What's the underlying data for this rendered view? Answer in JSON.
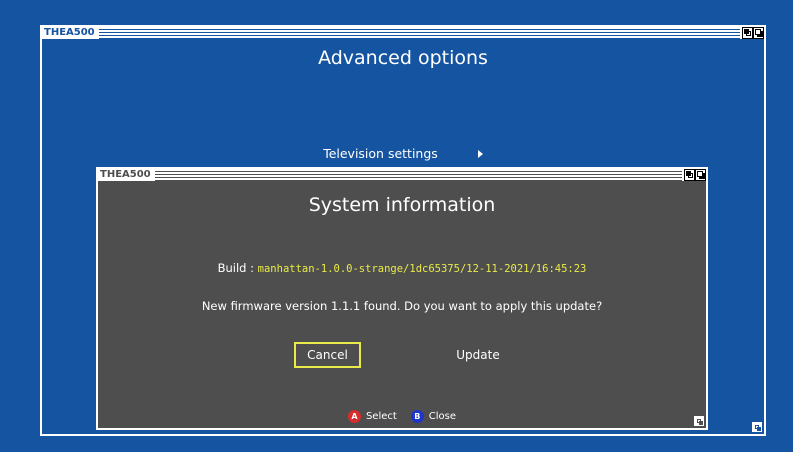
{
  "colors": {
    "screen_background": "#1554a0",
    "dialog_background": "#4e4e4e",
    "highlight": "#e9ea4a",
    "button_a": "#d62d2d",
    "button_b": "#1d35c9"
  },
  "back_window": {
    "title": "THEA500",
    "heading": "Advanced options",
    "menu_item": "Television settings",
    "menu_item_icon": "chevron-right-icon"
  },
  "dialog": {
    "title": "THEA500",
    "heading": "System information",
    "build_label": "Build : ",
    "build_value": "manhattan-1.0.0-strange/1dc65375/12-11-2021/16:45:23",
    "message": "New firmware version 1.1.1 found. Do you want to apply this update?",
    "buttons": {
      "cancel": "Cancel",
      "update": "Update",
      "selected": "Cancel"
    },
    "hints": [
      {
        "key": "A",
        "label": "Select"
      },
      {
        "key": "B",
        "label": "Close"
      }
    ]
  }
}
